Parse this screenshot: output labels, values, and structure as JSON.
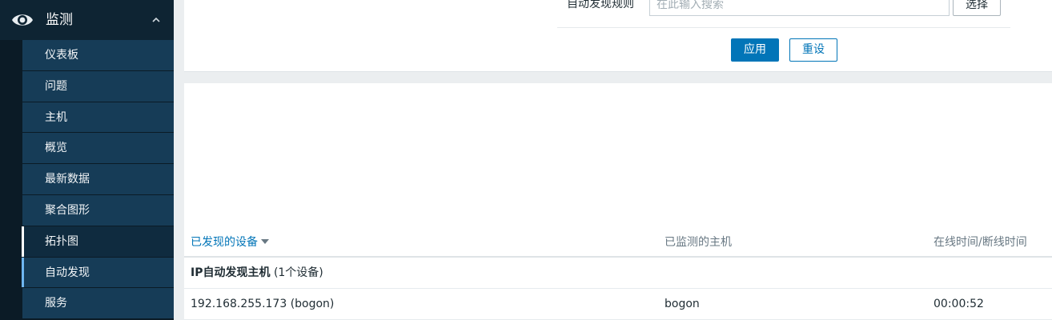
{
  "sidebar": {
    "section_title": "监测",
    "section_icon": "eye-icon",
    "collapse_icon": "chevron-up-icon",
    "items": [
      {
        "label": "仪表板"
      },
      {
        "label": "问题"
      },
      {
        "label": "主机"
      },
      {
        "label": "概览"
      },
      {
        "label": "最新数据"
      },
      {
        "label": "聚合图形"
      },
      {
        "label": "拓扑图"
      },
      {
        "label": "自动发现"
      },
      {
        "label": "服务"
      }
    ],
    "active_item": "自动发现"
  },
  "filter": {
    "discovery_rule_label": "自动发现规则",
    "search_placeholder": "在此输入搜索",
    "select_label": "选择",
    "apply_label": "应用",
    "reset_label": "重设"
  },
  "table": {
    "columns": [
      "已发现的设备",
      "已监测的主机",
      "在线时间/断线时间"
    ],
    "sorted_column": "已发现的设备",
    "group": {
      "name": "IP自动发现主机",
      "count_text": "(1个设备)"
    },
    "rows": [
      {
        "device": "192.168.255.173 (bogon)",
        "host": "bogon",
        "uptime": "00:00:52"
      }
    ]
  },
  "colors": {
    "accent": "#0275b8",
    "sidebar_bg": "#0b1b26",
    "sidebar_item_bg": "#163c57",
    "active_marker": "#6fb6f0"
  }
}
